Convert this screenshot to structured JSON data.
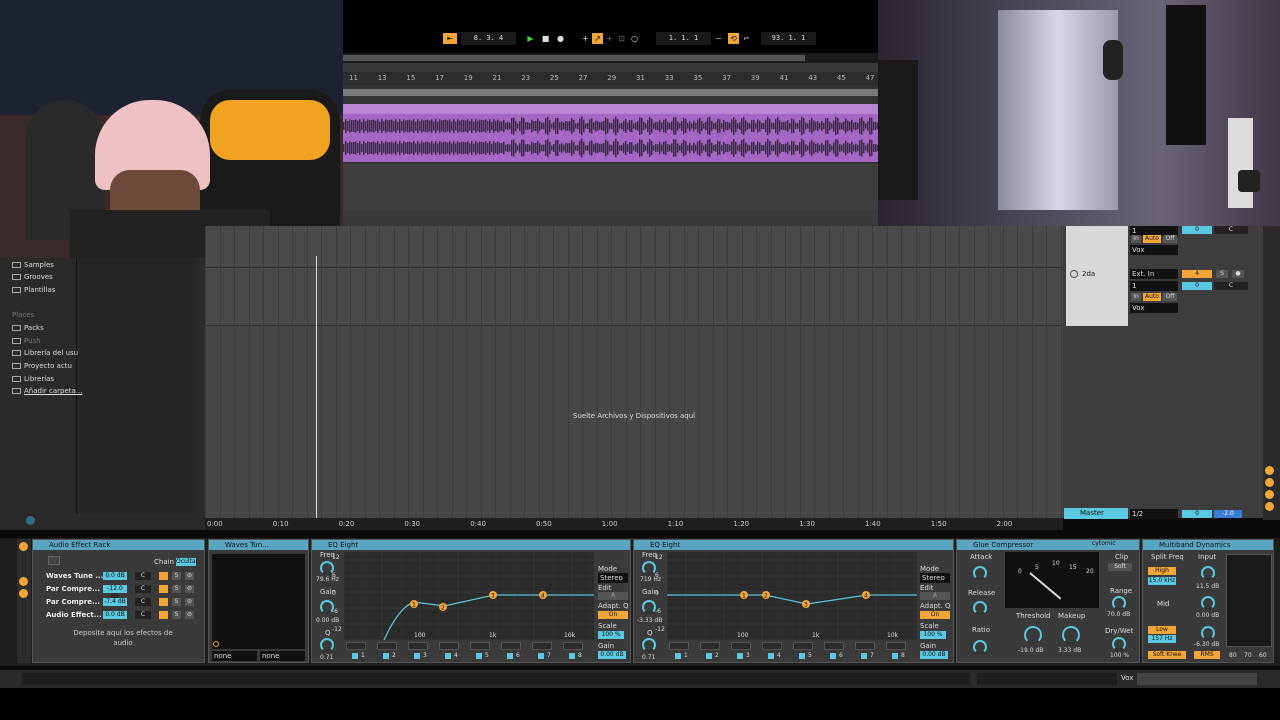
{
  "transport": {
    "position": "8.  3.  4",
    "loop_start": "1.  1.  1",
    "loop_length": "93.  1.  1"
  },
  "ruler_ticks": [
    "11",
    "13",
    "15",
    "17",
    "19",
    "21",
    "23",
    "25",
    "27",
    "29",
    "31",
    "33",
    "35",
    "37",
    "39",
    "41",
    "43",
    "45",
    "47"
  ],
  "browser": {
    "items": [
      "Samples",
      "Grooves",
      "Plantillas"
    ],
    "places_title": "Places",
    "places": [
      "Packs",
      "Push",
      "Librería del usu",
      "Proyecto actu",
      "Librerías",
      "Añadir carpeta..."
    ]
  },
  "drop_text": "Suelte Archivos y Dispositivos aquí",
  "timeline": [
    "0:00",
    "0:10",
    "0:20",
    "0:30",
    "0:40",
    "0:50",
    "1:00",
    "1:10",
    "1:20",
    "1:30",
    "1:40",
    "1:50",
    "2:00"
  ],
  "tracks": {
    "track2_name": "2da",
    "input_type": "Ext. In",
    "input_channel": "1",
    "monitor": [
      "In",
      "Auto",
      "Off"
    ],
    "output": "Vox",
    "track_number": "4",
    "solo": "S",
    "volume": "0",
    "pan": "C",
    "master_name": "Master",
    "master_io": "1/2",
    "master_vol": "0",
    "master_peak": "-2.0"
  },
  "rack": {
    "title": "Audio Effect Rack",
    "chain_label": "Chain",
    "chain_tab": "Ocultar",
    "chains": [
      {
        "name": "Waves Tune ...",
        "vol": "0.0 dB",
        "pan": "C"
      },
      {
        "name": "Par Compre...",
        "vol": "-12.0 dB",
        "pan": "C"
      },
      {
        "name": "Par Compre...",
        "vol": "-7.4 dB",
        "pan": "C"
      },
      {
        "name": "Audio Effect...",
        "vol": "0.0 dB",
        "pan": "C"
      }
    ],
    "drop_hint": "Deposite aquí los efectos de audio"
  },
  "waves": {
    "title": "Waves Tun...",
    "sel1": "none",
    "sel2": "none"
  },
  "eq1": {
    "title": "EQ Eight",
    "freq_label": "Freq",
    "freq": "79.6 Hz",
    "gain_label": "Gain",
    "gain": "0.00 dB",
    "q_label": "Q",
    "q": "0.71",
    "mode_label": "Mode",
    "mode": "Stereo",
    "edit_label": "Edit",
    "edit_val": "A",
    "adapt_label": "Adapt. Q",
    "adapt": "On",
    "scale_label": "Scale",
    "scale": "100 %",
    "outgain_label": "Gain",
    "outgain": "0.00 dB",
    "ylabels": [
      "12",
      "6",
      "0",
      "-6",
      "-12"
    ],
    "xlabels": [
      "100",
      "1k",
      "10k"
    ],
    "bands": [
      "1",
      "2",
      "3",
      "4",
      "5",
      "6",
      "7",
      "8"
    ],
    "nodes": [
      "1",
      "2",
      "3",
      "4"
    ]
  },
  "eq2": {
    "title": "EQ Eight",
    "freq_label": "Freq",
    "freq": "719 Hz",
    "gain_label": "Gain",
    "gain": "-3.33 dB",
    "q_label": "Q",
    "q": "0.71",
    "mode_label": "Mode",
    "mode": "Stereo",
    "edit_label": "Edit",
    "edit_val": "A",
    "adapt_label": "Adapt. Q",
    "adapt": "On",
    "scale_label": "Scale",
    "scale": "100 %",
    "outgain_label": "Gain",
    "outgain": "0.00 dB",
    "ylabels": [
      "12",
      "6",
      "0",
      "-6",
      "-12"
    ],
    "xlabels": [
      "100",
      "1k",
      "10k"
    ],
    "bands": [
      "1",
      "2",
      "3",
      "4",
      "5",
      "6",
      "7",
      "8"
    ],
    "nodes": [
      "1",
      "2",
      "3",
      "4"
    ]
  },
  "glue": {
    "title": "Glue Compressor",
    "brand": "cytomic",
    "attack_label": "Attack",
    "release_label": "Release",
    "ratio_label": "Ratio",
    "clip_label": "Clip",
    "soft": "Soft",
    "threshold_label": "Threshold",
    "threshold": "-19.0 dB",
    "makeup_label": "Makeup",
    "makeup": "3.33 dB",
    "range_label": "Range",
    "range": "70.0 dB",
    "drywet_label": "Dry/Wet",
    "drywet": "100 %",
    "meter_ticks": [
      "0",
      "5",
      "10",
      "15",
      "20"
    ]
  },
  "multiband": {
    "title": "Multiband Dynamics",
    "split_label": "Split Freq",
    "input_label": "Input",
    "high": "High",
    "high_freq": "15.0 kHz",
    "high_in": "11.5 dB",
    "mid": "Mid",
    "mid_in": "0.00 dB",
    "low": "Low",
    "low_freq": "157 Hz",
    "low_in": "-6.30 dB",
    "softknee": "Soft Knee",
    "rms": "RMS",
    "scale": [
      "80",
      "70",
      "60"
    ]
  },
  "status": {
    "track": "Vox"
  }
}
